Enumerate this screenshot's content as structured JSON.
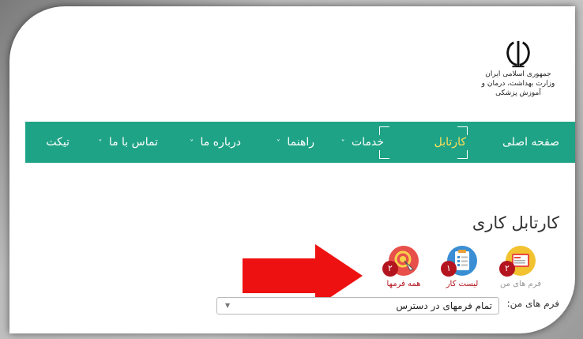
{
  "logo": {
    "line1": "جمهوری اسلامی ایران",
    "line2": "وزارت بهداشت، درمان و آموزش پزشکی"
  },
  "nav": {
    "items": [
      {
        "label": "صفحه اصلی"
      },
      {
        "label": "کارتابل"
      },
      {
        "label": "خدمات"
      },
      {
        "label": "راهنما"
      },
      {
        "label": "درباره ما"
      },
      {
        "label": "تماس با ما"
      },
      {
        "label": "تیکت"
      }
    ],
    "chevron": "˅"
  },
  "main": {
    "title": "کارتابل کاری",
    "cards": [
      {
        "label": "فرم های من",
        "badge": "۲",
        "icon": "form-icon",
        "label_color": "#9a9a9a"
      },
      {
        "label": "لیست کار",
        "badge": "۱",
        "icon": "clipboard-list-icon",
        "label_color": "#b3141e"
      },
      {
        "label": "همه فرمها",
        "badge": "۲",
        "icon": "pointer-click-icon",
        "label_color": "#b3141e"
      }
    ],
    "filter_label": "فرم های من:",
    "filter_value": "تمام فرمهای در دسترس",
    "caret": "▼"
  },
  "colors": {
    "nav_bg": "#1fa386",
    "nav_active": "#ffe15a",
    "badge": "#b3141e",
    "arrow": "#ee1111"
  }
}
